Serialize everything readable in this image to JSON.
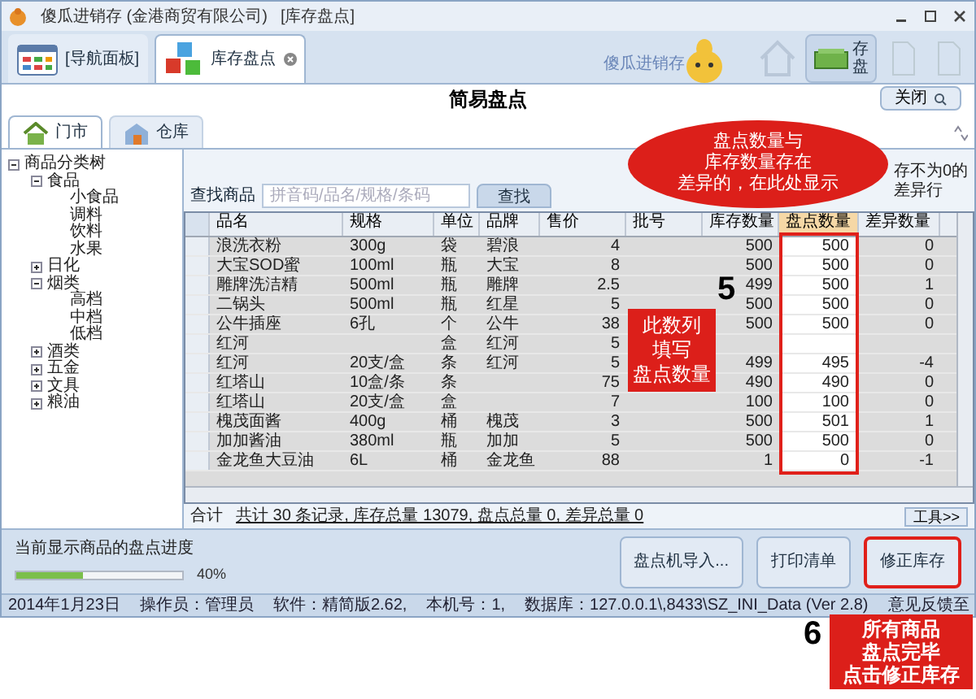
{
  "window": {
    "title": "傻瓜进销存 (金港商贸有限公司)",
    "document": "[库存盘点]"
  },
  "doc_tabs": [
    {
      "label": "[导航面板]",
      "selected": false
    },
    {
      "label": "库存盘点",
      "selected": true
    }
  ],
  "logo_text": "傻瓜进销存",
  "toolbar": [
    {
      "label": "存盘",
      "disabled": false
    },
    {
      "disabled": true
    },
    {
      "disabled": true
    }
  ],
  "header": {
    "title": "简易盘点",
    "close": "关闭"
  },
  "store_tabs": [
    {
      "label": "门市",
      "selected": true
    },
    {
      "label": "仓库",
      "selected": false
    }
  ],
  "tree": {
    "label": "商品分类树",
    "expanded": true,
    "children": [
      {
        "label": "食品",
        "expanded": true,
        "children": [
          {
            "label": "小食品"
          },
          {
            "label": "调料"
          },
          {
            "label": "饮料"
          },
          {
            "label": "水果"
          }
        ]
      },
      {
        "label": "日化",
        "expanded": false
      },
      {
        "label": "烟类",
        "expanded": true,
        "children": [
          {
            "label": "高档"
          },
          {
            "label": "中档"
          },
          {
            "label": "低档"
          }
        ]
      },
      {
        "label": "酒类",
        "expanded": false
      },
      {
        "label": "五金",
        "expanded": false
      },
      {
        "label": "文具",
        "expanded": false
      },
      {
        "label": "粮油",
        "expanded": false
      }
    ]
  },
  "search": {
    "label": "查找商品",
    "placeholder": "拼音码/品名/规格/条码",
    "button": "查找"
  },
  "filter_note": [
    "存不为0的",
    "差异行"
  ],
  "table": {
    "columns": [
      {
        "label": "品名",
        "highlighted": false
      },
      {
        "label": "规格",
        "highlighted": false
      },
      {
        "label": "单位",
        "highlighted": false
      },
      {
        "label": "品牌",
        "highlighted": false
      },
      {
        "label": "售价",
        "highlighted": false
      },
      {
        "label": "批号",
        "highlighted": false
      },
      {
        "label": "库存数量",
        "highlighted": false
      },
      {
        "label": "盘点数量",
        "highlighted": true
      },
      {
        "label": "差异数量",
        "highlighted": false
      }
    ],
    "rows": [
      [
        "浪洗衣粉",
        "300g",
        "袋",
        "碧浪",
        "4",
        null,
        "500",
        "500",
        "0"
      ],
      [
        "大宝SOD蜜",
        "100ml",
        "瓶",
        "大宝",
        "8",
        null,
        "500",
        "500",
        "0"
      ],
      [
        "雕牌洗洁精",
        "500ml",
        "瓶",
        "雕牌",
        "2.5",
        null,
        "499",
        "500",
        "1"
      ],
      [
        "二锅头",
        "500ml",
        "瓶",
        "红星",
        "5",
        null,
        "500",
        "500",
        "0"
      ],
      [
        "公牛插座",
        "6孔",
        "个",
        "公牛",
        "38",
        null,
        "500",
        "500",
        "0"
      ],
      [
        "红河",
        null,
        "盒",
        "红河",
        "5",
        null,
        null,
        null,
        null
      ],
      [
        "红河",
        "20支/盒",
        "条",
        "红河",
        "5",
        null,
        "499",
        "495",
        "-4"
      ],
      [
        "红塔山",
        "10盒/条",
        "条",
        null,
        "75",
        null,
        "490",
        "490",
        "0"
      ],
      [
        "红塔山",
        "20支/盒",
        "盒",
        null,
        "7",
        null,
        "100",
        "100",
        "0"
      ],
      [
        "槐茂面酱",
        "400g",
        "桶",
        "槐茂",
        "3",
        null,
        "500",
        "501",
        "1"
      ],
      [
        "加加酱油",
        "380ml",
        "瓶",
        "加加",
        "5",
        null,
        "500",
        "500",
        "0"
      ],
      [
        "金龙鱼大豆油",
        "6L",
        "桶",
        "金龙鱼",
        "88",
        null,
        "1",
        "0",
        "-1"
      ]
    ]
  },
  "totals": {
    "label": "合计",
    "summary": "共计 30 条记录, 库存总量 13079, 盘点总量 0, 差异总量 0",
    "tools": "工具>>"
  },
  "progress": {
    "label": "当前显示商品的盘点进度",
    "level": 0.4,
    "reading": "40%"
  },
  "actions": [
    {
      "label": "盘点机导入...",
      "highlighted": false
    },
    {
      "label": "打印清单",
      "highlighted": false
    },
    {
      "label": "修正库存",
      "highlighted": true
    }
  ],
  "status_bar": [
    "2014年1月23日",
    "操作员：管理员",
    "软件：精简版2.62,",
    "本机号：1,",
    "数据库：127.0.0.1\\,8433\\SZ_INI_Data (Ver 2.8)",
    "意见反馈至"
  ],
  "callout": [
    "盘点数量与",
    "库存数量存在",
    "差异的，在此处显示"
  ],
  "steps": [
    {
      "number": "5",
      "note": [
        "此数列",
        "填写",
        "盘点数量"
      ]
    },
    {
      "number": "6",
      "note": [
        "所有商品",
        "盘点完毕",
        "点击修正库存"
      ]
    }
  ]
}
